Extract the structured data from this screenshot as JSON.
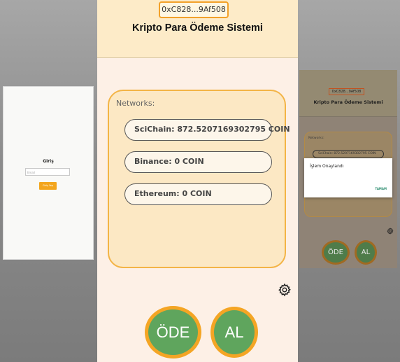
{
  "login_screen": {
    "title": "Giriş",
    "email_placeholder": "Email",
    "login_button": "Giriş Yap"
  },
  "main_screen": {
    "wallet_address": "0xC828...9Af508",
    "title": "Kripto Para Ödeme Sistemi",
    "networks_label": "Networks:",
    "networks": [
      {
        "label": "SciChain: 872.5207169302795 COIN"
      },
      {
        "label": "Binance: 0 COIN"
      },
      {
        "label": "Ethereum: 0 COIN"
      }
    ],
    "pay_button": "ÖDE",
    "receive_button": "AL",
    "settings_icon": "gear-icon"
  },
  "confirm_screen": {
    "wallet_address": "0xC828...9Af508",
    "title": "Kripto Para Ödeme Sistemi",
    "networks_label": "Networks:",
    "network_item": "SciChain: 872.5207169302795 COIN",
    "dialog_message": "İşlem Onaylandı",
    "dialog_button": "TAMAM",
    "pay_button": "ÖDE",
    "receive_button": "AL"
  },
  "colors": {
    "accent_orange": "#f4a524",
    "button_green": "#5fa55d",
    "header_bg": "#fdebc8",
    "card_bg": "#fce8c4"
  }
}
